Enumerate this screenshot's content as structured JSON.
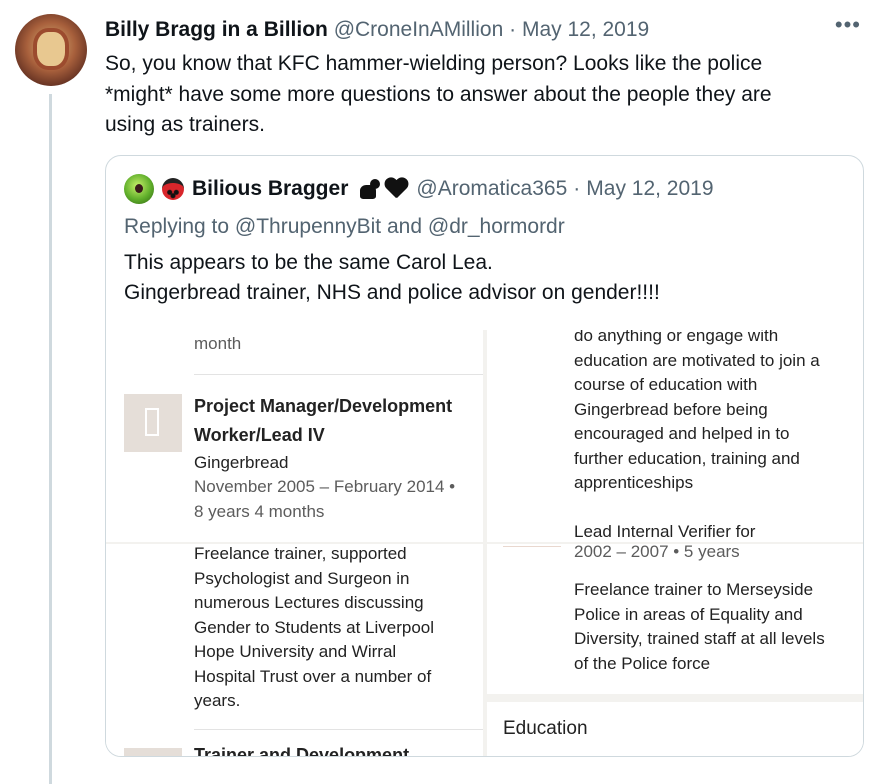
{
  "tweet": {
    "author_name": "Billy Bragg in a Billion",
    "handle": "@CroneInAMillion",
    "separator": "·",
    "date": "May 12, 2019",
    "more_icon": "more-horizontal-icon",
    "text_lines": [
      "So, you know that KFC hammer-wielding person?  Looks like the police",
      "*might* have some more questions to answer about the people they are",
      "using as trainers."
    ]
  },
  "quote": {
    "author_name": "Bilious Bragger",
    "handle": "@Aromatica365",
    "separator": "·",
    "date": "May 12, 2019",
    "replying_prefix": "Replying to",
    "reply_user1": "@ThrupennyBit",
    "reply_and": "and",
    "reply_user2": "@dr_hormordr",
    "text_lines": [
      "This appears to be the same Carol Lea.",
      "Gingerbread trainer, NHS and police advisor on gender!!!!"
    ]
  },
  "screenshot": {
    "left_top": "month",
    "job_title_line1": "Project Manager/Development",
    "job_title_line2": "Worker/Lead IV",
    "company": "Gingerbread",
    "dates_line1": "November 2005 – February 2014 •",
    "dates_line2": "8 years 4 months",
    "left_desc": [
      "Freelance trainer, supported",
      "Psychologist and Surgeon in",
      "numerous Lectures discussing",
      "Gender to Students at Liverpool",
      "Hope University and Wirral",
      "Hospital Trust over a number of",
      "years."
    ],
    "left_bottom_partial": "Trainer and Development",
    "right_top": [
      "do anything or engage with",
      "education are motivated to join a",
      "course of education with",
      "Gingerbread before being",
      "encouraged and helped in to",
      "further education, training and",
      "apprenticeships"
    ],
    "right_verifier": "Lead Internal Verifier for",
    "right_verifier_dates": "2002 – 2007 • 5 years",
    "right_desc": [
      "Freelance trainer to Merseyside",
      "Police in areas of Equality and",
      "Diversity, trained staff at all levels",
      "of the Police force"
    ],
    "education_label": "Education"
  }
}
